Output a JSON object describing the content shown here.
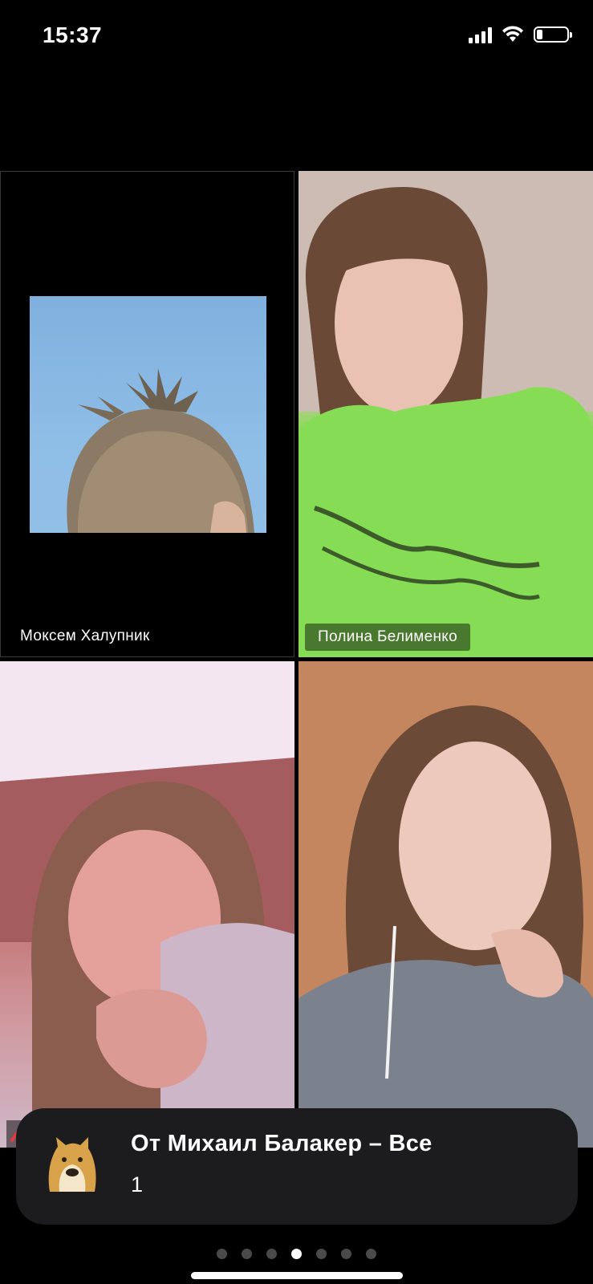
{
  "status_bar": {
    "time": "15:37",
    "icons": [
      "cellular-signal-icon",
      "wifi-icon",
      "battery-icon"
    ],
    "battery_fraction": 0.2
  },
  "participants": [
    {
      "name": "Моксем Халупник",
      "video": "avatar-photo"
    },
    {
      "name": "Полина Белименко",
      "video": "camera"
    },
    {
      "name": "",
      "video": "camera",
      "muted": true
    },
    {
      "name": "",
      "video": "camera"
    }
  ],
  "notification": {
    "title": "От Михаил Балакер – Все",
    "body": "1",
    "avatar_icon": "doge-avatar-icon"
  },
  "pager": {
    "total": 7,
    "active_index": 3
  },
  "colors": {
    "background": "#000000",
    "notification_bg": "#1c1c1e",
    "dot_inactive": "#4a4a4a",
    "dot_active": "#ffffff"
  }
}
